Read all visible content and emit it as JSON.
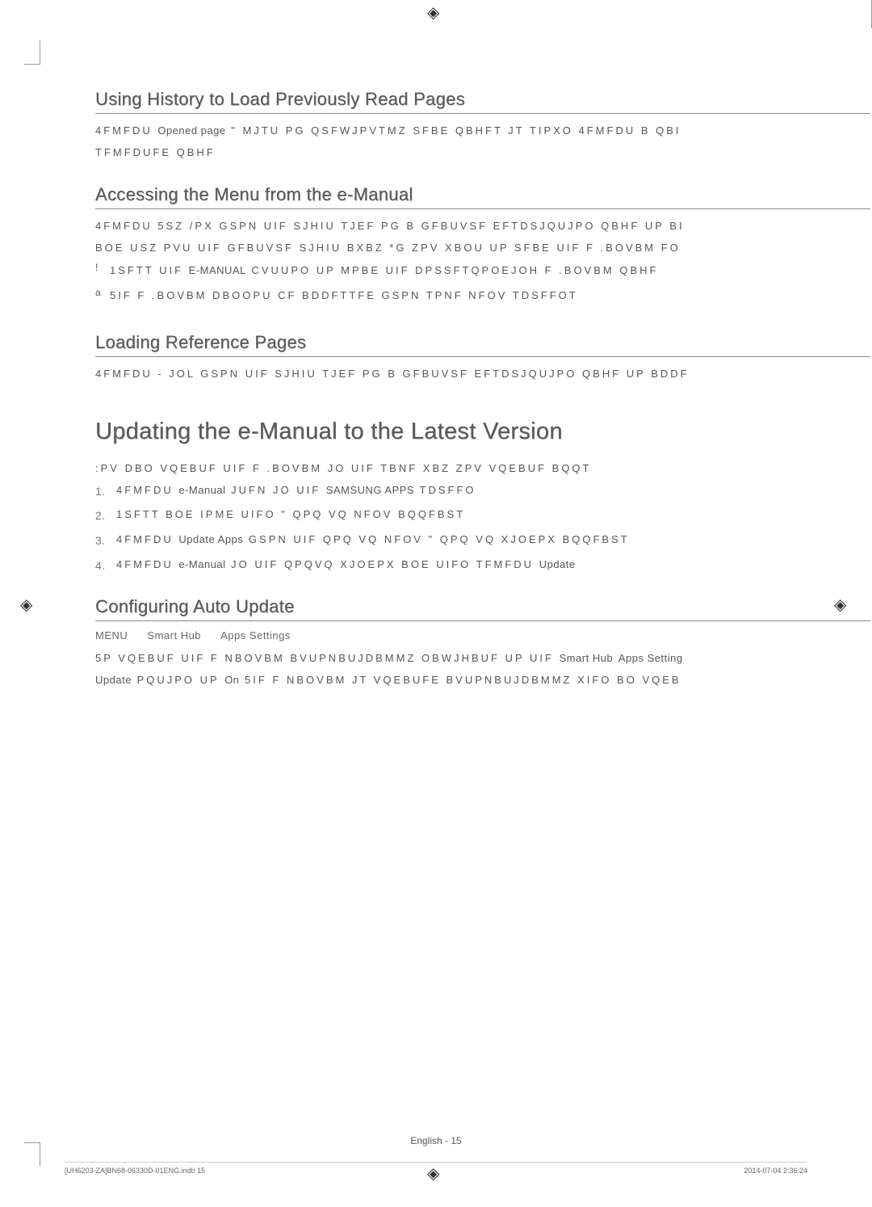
{
  "sections": {
    "history": {
      "heading": "Using History to Load Previously Read Pages",
      "p1_a": "4FMFDU",
      "p1_opened": "Opened page",
      "p1_b": "\" MJTU PG QSFWJPVTMZ SFBE QBHFT JT TIPXO  4FMFDU B QBI",
      "p1_c": "TFMFDUFE QBHF"
    },
    "menu_access": {
      "heading": "Accessing the Menu from the e-Manual",
      "p1": "4FMFDU 5SZ /PX   GSPN UIF SJHIU TJEF PG B GFBUVSF EFTDSJQUJPO QBHF UP BI",
      "p2": "BOE  USZ  PVU  UIF  GFBUVSF  SJHIU  BXBZ   *G  ZPV  XBOU  UP  SFBE  UIF  F .BOVBM  FO",
      "note1_a": "1SFTT UIF",
      "note1_btn": "E-MANUAL",
      "note1_b": "CVUUPO UP MPBE UIF DPSSFTQPOEJOH F .BOVBM QBHF",
      "note2_a": "5IF F .BOVBM DBOOPU CF BDDFTTFE GSPN TPNF NFOV TDSFFOT"
    },
    "loading_ref": {
      "heading": "Loading Reference Pages",
      "p1": "4FMFDU - JOL   GSPN UIF SJHIU TJEF PG B GFBUVSF EFTDSJQUJPO QBHF UP BDDF"
    },
    "updating": {
      "heading": "Updating the e-Manual to the Latest Version",
      "p1": ":PV DBO VQEBUF UIF F .BOVBM JO UIF TBNF XBZ ZPV VQEBUF BQQT",
      "steps": {
        "s1_a": "4FMFDU",
        "s1_em": "e-Manual",
        "s1_b": "JUFN JO UIF",
        "s1_apps": "SAMSUNG APPS",
        "s1_c": "TDSFFO",
        "s2": "1SFTT BOE  IPME UIFO   \" QPQ VQ NFOV BQQFBST",
        "s3_a": "4FMFDU",
        "s3_upd": "Update Apps",
        "s3_b": "GSPN UIF QPQ VQ NFOV  \" QPQ VQ XJOEPX BQQFBST",
        "s4_a": "4FMFDU",
        "s4_em": "e-Manual",
        "s4_b": "JO UIF QPQVQ XJOEPX  BOE UIFO TFMFDU",
        "s4_upd": "Update"
      }
    },
    "auto_update": {
      "heading": "Configuring Auto Update",
      "breadcrumb": {
        "a": "MENU",
        "b": "Smart Hub",
        "c": "Apps Settings"
      },
      "p1_a": "5P VQEBUF UIF F NBOVBM BVUPNBUJDBMMZ  OBWJHBUF UP UIF",
      "p1_sh": "Smart Hub",
      "p1_as": "Apps Setting",
      "p2_upd": "Update",
      "p2_a": "PQUJPO UP",
      "p2_on": "On",
      "p2_b": "5IF F NBOVBM JT VQEBUFE BVUPNBUJDBMMZ XIFO BO VQEB"
    }
  },
  "footer": {
    "page": "English - 15",
    "file": "[UH6203-ZA]BN68-06330D-01ENG.indb   15",
    "timestamp": "2014-07-04   2:36:24"
  }
}
